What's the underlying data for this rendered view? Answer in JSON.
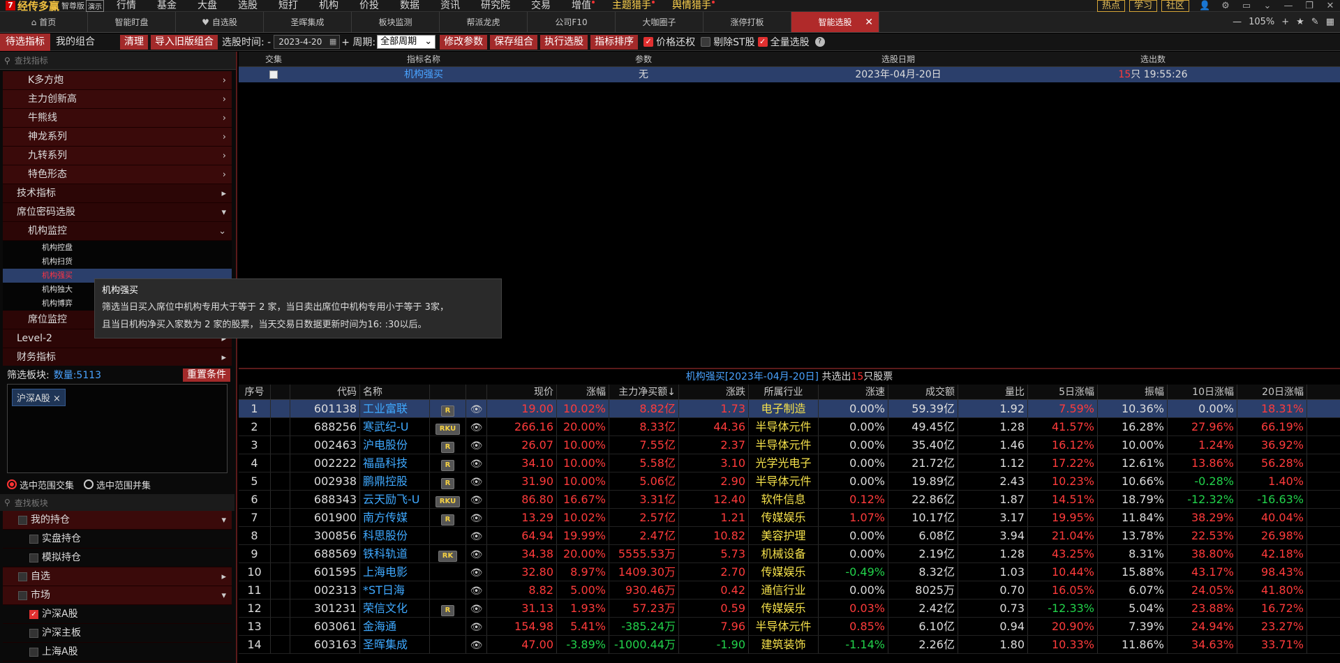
{
  "app": {
    "name": "经传多赢",
    "edition": "智尊版",
    "demo": "演示"
  },
  "top_menu": [
    "行情",
    "基金",
    "大盘",
    "选股",
    "短打",
    "机构",
    "价投",
    "数据",
    "资讯",
    "研究院",
    "交易",
    "增值",
    "主题猎手",
    "舆情猎手"
  ],
  "top_right": {
    "hot": "热点",
    "learn": "学习",
    "community": "社区"
  },
  "tabs": [
    "首页",
    "智能盯盘",
    "自选股",
    "圣晖集成",
    "板块监测",
    "帮派龙虎",
    "公司F10",
    "大咖圈子",
    "涨停打板",
    "智能选股"
  ],
  "zoom": "105%",
  "toolbar": {
    "tab_pending": "待选指标",
    "tab_mine": "我的组合",
    "clear": "清理",
    "import": "导入旧版组合",
    "date_label": "选股时间: -",
    "date": "2023-4-20",
    "period_label": "周期:",
    "period": "全部周期",
    "modify": "修改参数",
    "save": "保存组合",
    "execute": "执行选股",
    "sort": "指标排序",
    "restore": "价格还权",
    "exclude_st": "剔除ST股",
    "all": "全量选股"
  },
  "left": {
    "search_placeholder": "查找指标",
    "tree": [
      {
        "label": "K多方炮",
        "level": 2
      },
      {
        "label": "主力创新高",
        "level": 2
      },
      {
        "label": "牛熊线",
        "level": 2
      },
      {
        "label": "神龙系列",
        "level": 2
      },
      {
        "label": "九转系列",
        "level": 2
      },
      {
        "label": "特色形态",
        "level": 2
      },
      {
        "label": "技术指标",
        "level": 1
      },
      {
        "label": "席位密码选股",
        "level": 1
      },
      {
        "label": "机构监控",
        "level": 2
      },
      {
        "label": "机构控盘",
        "level": 3
      },
      {
        "label": "机构扫货",
        "level": 3
      },
      {
        "label": "机构强买",
        "level": 3
      },
      {
        "label": "机构独大",
        "level": 3
      },
      {
        "label": "机构博弈",
        "level": 3
      },
      {
        "label": "席位监控",
        "level": 2
      },
      {
        "label": "Level-2",
        "level": 1
      },
      {
        "label": "财务指标",
        "level": 1
      }
    ],
    "filter_label": "筛选板块:",
    "count_label": "数量:5113",
    "reset": "重置条件",
    "chip": "沪深A股",
    "radio_intersect": "选中范围交集",
    "radio_union": "选中范围并集",
    "board_search_placeholder": "查找板块",
    "boards": [
      {
        "label": "我的持仓",
        "level": 1
      },
      {
        "label": "实盘持仓",
        "level": 2
      },
      {
        "label": "模拟持仓",
        "level": 2
      },
      {
        "label": "自选",
        "level": 1
      },
      {
        "label": "市场",
        "level": 1
      },
      {
        "label": "沪深A股",
        "level": 2
      },
      {
        "label": "沪深主板",
        "level": 2
      },
      {
        "label": "上海A股",
        "level": 2
      }
    ]
  },
  "tooltip": {
    "title": "机构强买",
    "line1": "筛选当日买入席位中机构专用大于等于 2 家，当日卖出席位中机构专用小于等于 3家，",
    "line2": "且当日机构净买入家数为 2 家的股票，当天交易日数据更新时间为16: :30以后。"
  },
  "result_table": {
    "headers": [
      "交集",
      "指标名称",
      "参数",
      "选股日期",
      "选出数"
    ],
    "row": {
      "name": "机构强买",
      "param": "无",
      "date": "2023年-04月-20日",
      "count": "15",
      "count_suffix": "只 19:55:26"
    }
  },
  "stocks_title": {
    "prefix": "机构强买[2023年-04月-20日]",
    "mid": " 共选出",
    "count": "15",
    "suffix": "只股票"
  },
  "stock_headers": [
    "序号",
    "代码",
    "名称",
    "",
    "",
    "现价",
    "涨幅",
    "主力净买额↓",
    "涨跌",
    "所属行业",
    "涨速",
    "成交额",
    "量比",
    "5日涨幅",
    "振幅",
    "10日涨幅",
    "20日涨幅"
  ],
  "stocks": [
    {
      "no": "1",
      "code": "601138",
      "name": "工业富联",
      "badge": "R",
      "price": "19.00",
      "chg": "10.02%",
      "net": "8.82亿",
      "diff": "1.73",
      "ind": "电子制造",
      "speed": "0.00%",
      "amt": "59.39亿",
      "vr": "1.92",
      "d5": "7.59%",
      "amp": "10.36%",
      "d10": "0.00%",
      "d20": "18.31%"
    },
    {
      "no": "2",
      "code": "688256",
      "name": "寒武纪-U",
      "badge": "RKU",
      "price": "266.16",
      "chg": "20.00%",
      "net": "8.33亿",
      "diff": "44.36",
      "ind": "半导体元件",
      "speed": "0.00%",
      "amt": "49.45亿",
      "vr": "1.28",
      "d5": "41.57%",
      "amp": "16.28%",
      "d10": "27.96%",
      "d20": "66.19%"
    },
    {
      "no": "3",
      "code": "002463",
      "name": "沪电股份",
      "badge": "R",
      "price": "26.07",
      "chg": "10.00%",
      "net": "7.55亿",
      "diff": "2.37",
      "ind": "半导体元件",
      "speed": "0.00%",
      "amt": "35.40亿",
      "vr": "1.46",
      "d5": "16.12%",
      "amp": "10.00%",
      "d10": "1.24%",
      "d20": "36.92%"
    },
    {
      "no": "4",
      "code": "002222",
      "name": "福晶科技",
      "badge": "R",
      "price": "34.10",
      "chg": "10.00%",
      "net": "5.58亿",
      "diff": "3.10",
      "ind": "光学光电子",
      "speed": "0.00%",
      "amt": "21.72亿",
      "vr": "1.12",
      "d5": "17.22%",
      "amp": "12.61%",
      "d10": "13.86%",
      "d20": "56.28%"
    },
    {
      "no": "5",
      "code": "002938",
      "name": "鹏鼎控股",
      "badge": "R",
      "price": "31.90",
      "chg": "10.00%",
      "net": "5.06亿",
      "diff": "2.90",
      "ind": "半导体元件",
      "speed": "0.00%",
      "amt": "19.89亿",
      "vr": "2.43",
      "d5": "10.23%",
      "amp": "10.66%",
      "d10": "-0.28%",
      "d20": "1.40%"
    },
    {
      "no": "6",
      "code": "688343",
      "name": "云天励飞-U",
      "badge": "RKU",
      "price": "86.80",
      "chg": "16.67%",
      "net": "3.31亿",
      "diff": "12.40",
      "ind": "软件信息",
      "speed": "0.12%",
      "amt": "22.86亿",
      "vr": "1.87",
      "d5": "14.51%",
      "amp": "18.79%",
      "d10": "-12.32%",
      "d20": "-16.63%"
    },
    {
      "no": "7",
      "code": "601900",
      "name": "南方传媒",
      "badge": "R",
      "price": "13.29",
      "chg": "10.02%",
      "net": "2.57亿",
      "diff": "1.21",
      "ind": "传媒娱乐",
      "speed": "1.07%",
      "amt": "10.17亿",
      "vr": "3.17",
      "d5": "19.95%",
      "amp": "11.84%",
      "d10": "38.29%",
      "d20": "40.04%"
    },
    {
      "no": "8",
      "code": "300856",
      "name": "科思股份",
      "badge": "",
      "price": "64.94",
      "chg": "19.99%",
      "net": "2.47亿",
      "diff": "10.82",
      "ind": "美容护理",
      "speed": "0.00%",
      "amt": "6.08亿",
      "vr": "3.94",
      "d5": "21.04%",
      "amp": "13.78%",
      "d10": "22.53%",
      "d20": "26.98%"
    },
    {
      "no": "9",
      "code": "688569",
      "name": "铁科轨道",
      "badge": "RK",
      "price": "34.38",
      "chg": "20.00%",
      "net": "5555.53万",
      "diff": "5.73",
      "ind": "机械设备",
      "speed": "0.00%",
      "amt": "2.19亿",
      "vr": "1.28",
      "d5": "43.25%",
      "amp": "8.31%",
      "d10": "38.80%",
      "d20": "42.18%"
    },
    {
      "no": "10",
      "code": "601595",
      "name": "上海电影",
      "badge": "",
      "price": "32.80",
      "chg": "8.97%",
      "net": "1409.30万",
      "diff": "2.70",
      "ind": "传媒娱乐",
      "speed": "-0.49%",
      "amt": "8.32亿",
      "vr": "1.03",
      "d5": "10.44%",
      "amp": "15.88%",
      "d10": "43.17%",
      "d20": "98.43%"
    },
    {
      "no": "11",
      "code": "002313",
      "name": "*ST日海",
      "badge": "",
      "price": "8.82",
      "chg": "5.00%",
      "net": "930.46万",
      "diff": "0.42",
      "ind": "通信行业",
      "speed": "0.00%",
      "amt": "8025万",
      "vr": "0.70",
      "d5": "16.05%",
      "amp": "6.07%",
      "d10": "24.05%",
      "d20": "41.80%"
    },
    {
      "no": "12",
      "code": "301231",
      "name": "荣信文化",
      "badge": "R",
      "price": "31.13",
      "chg": "1.93%",
      "net": "57.23万",
      "diff": "0.59",
      "ind": "传媒娱乐",
      "speed": "0.03%",
      "amt": "2.42亿",
      "vr": "0.73",
      "d5": "-12.33%",
      "amp": "5.04%",
      "d10": "23.88%",
      "d20": "16.72%"
    },
    {
      "no": "13",
      "code": "603061",
      "name": "金海通",
      "badge": "",
      "price": "154.98",
      "chg": "5.41%",
      "net": "-385.24万",
      "diff": "7.96",
      "ind": "半导体元件",
      "speed": "0.85%",
      "amt": "6.10亿",
      "vr": "0.94",
      "d5": "20.90%",
      "amp": "7.39%",
      "d10": "24.94%",
      "d20": "23.27%"
    },
    {
      "no": "14",
      "code": "603163",
      "name": "圣晖集成",
      "badge": "",
      "price": "47.00",
      "chg": "-3.89%",
      "net": "-1000.44万",
      "diff": "-1.90",
      "ind": "建筑装饰",
      "speed": "-1.14%",
      "amt": "2.26亿",
      "vr": "1.80",
      "d5": "10.33%",
      "amp": "11.86%",
      "d10": "34.63%",
      "d20": "33.71%"
    }
  ],
  "colors": {
    "up": "#ff3b3b",
    "down": "#22d34b",
    "accent": "#a32a2a",
    "selected": "#2b3f6b",
    "link": "#3fa9ff"
  }
}
